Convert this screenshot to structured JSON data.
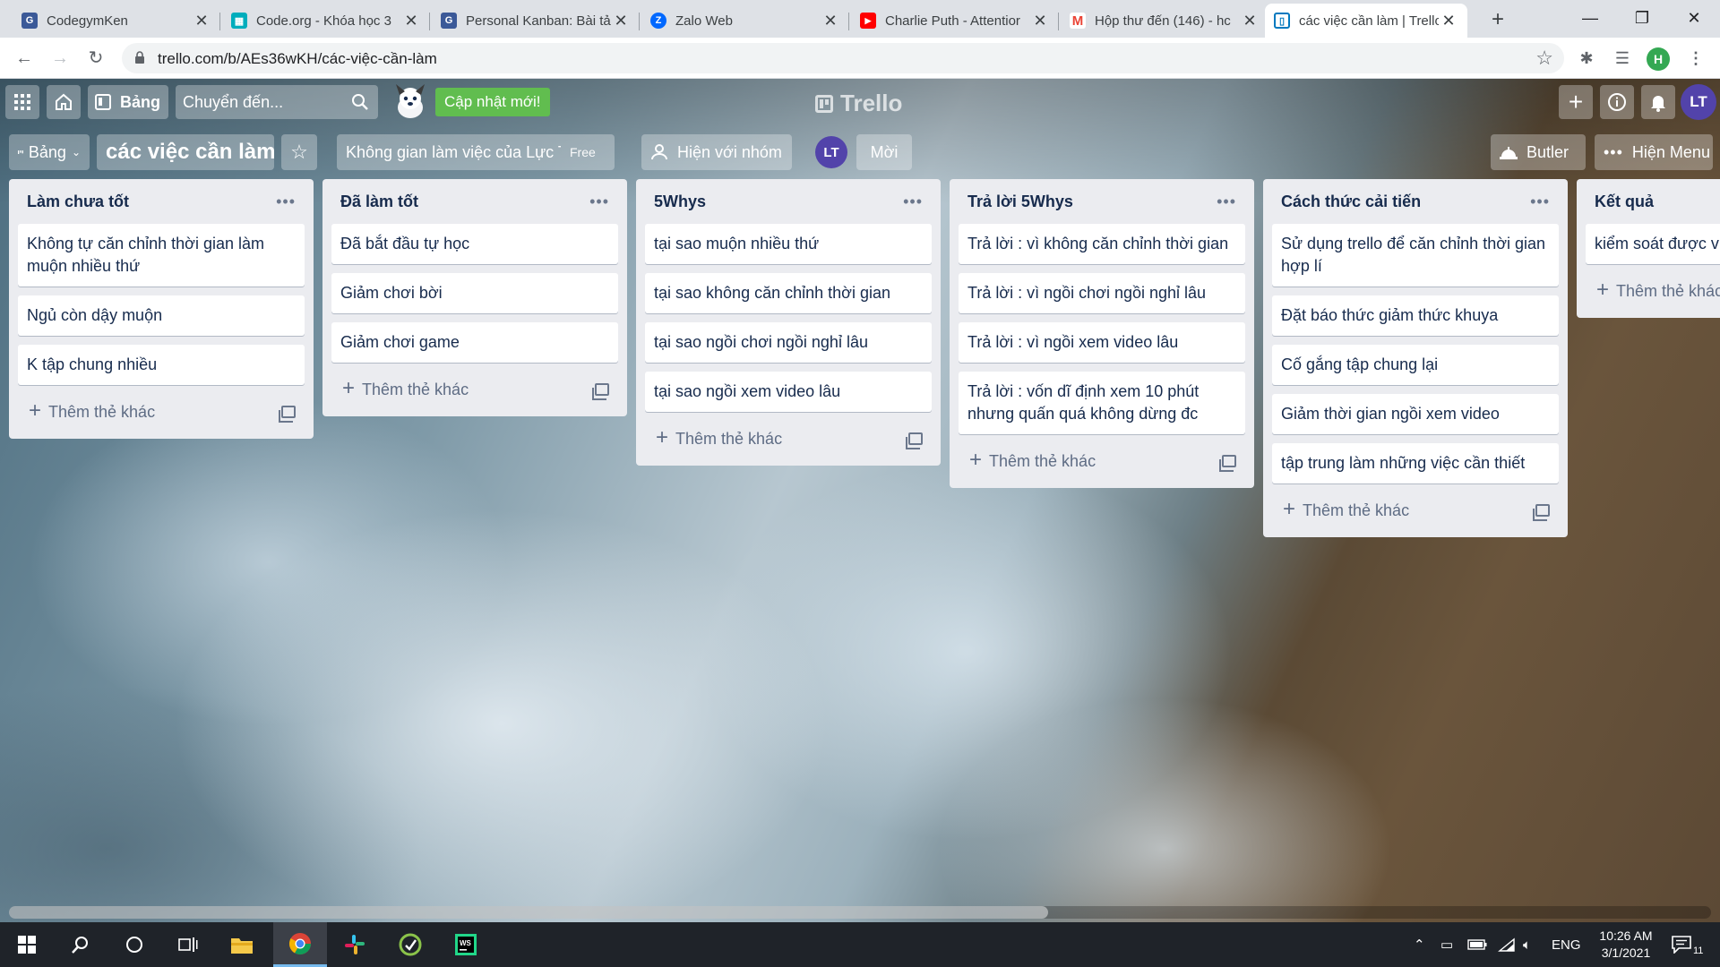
{
  "browser": {
    "tabs": [
      {
        "title": "CodegymKen",
        "favicon": "codegym-icon",
        "color": "#3b5998",
        "glyph": "G"
      },
      {
        "title": "Code.org - Khóa học 3",
        "favicon": "codeorg-icon",
        "color": "#00adbc",
        "glyph": "▦"
      },
      {
        "title": "Personal Kanban: Bài tả",
        "favicon": "codegym-icon",
        "color": "#3b5998",
        "glyph": "G"
      },
      {
        "title": "Zalo Web",
        "favicon": "zalo-icon",
        "color": "#0068ff",
        "glyph": "Z"
      },
      {
        "title": "Charlie Puth - Attentior",
        "favicon": "youtube-icon",
        "color": "#ff0000",
        "glyph": "▶"
      },
      {
        "title": "Hộp thư đến (146) - hc",
        "favicon": "gmail-icon",
        "color": "#ea4335",
        "glyph": "M"
      },
      {
        "title": "các việc cần làm | Trello",
        "favicon": "trello-icon",
        "color": "#0079bf",
        "glyph": "▯"
      }
    ],
    "url": "trello.com/b/AEs36wKH/các-việc-cần-làm",
    "profile_initial": "H"
  },
  "trello": {
    "header": {
      "boards_label": "Bảng",
      "search_placeholder": "Chuyển đến...",
      "update_label": "Cập nhật mới!",
      "logo_text": "Trello",
      "avatar_initials": "LT"
    },
    "board": {
      "switcher_label": "Bảng",
      "title": "các việc cần làm",
      "workspace": "Không gian làm việc của Lực Tr",
      "workspace_badge": "Free",
      "visibility": "Hiện với nhóm",
      "member_initials": "LT",
      "invite": "Mời",
      "butler": "Butler",
      "menu": "Hiện Menu"
    },
    "add_card_label": "Thêm thẻ khác",
    "lists": [
      {
        "name": "Làm chưa tốt",
        "cards": [
          "Không tự căn chỉnh thời gian làm muộn nhiều thứ",
          "Ngủ còn dậy muộn",
          "K tập chung nhiều"
        ]
      },
      {
        "name": "Đã làm tốt",
        "cards": [
          "Đã bắt đầu tự học",
          "Giảm chơi bời",
          "Giảm chơi game"
        ]
      },
      {
        "name": "5Whys",
        "cards": [
          "tại sao muộn nhiều thứ",
          "tại sao không căn chỉnh thời gian",
          "tại sao ngồi chơi ngồi nghỉ lâu",
          "tại sao ngồi xem video lâu"
        ]
      },
      {
        "name": "Trả lời 5Whys",
        "cards": [
          "Trả lời : vì không căn chỉnh thời gian",
          "Trả lời : vì ngồi chơi ngồi nghỉ lâu",
          "Trả lời : vì ngồi xem video lâu",
          "Trả lời : vốn dĩ định xem 10 phút nhưng quấn quá không dừng đc"
        ]
      },
      {
        "name": "Cách thức cải tiến",
        "cards": [
          "Sử dụng trello để căn chỉnh thời gian hợp lí",
          "Đặt báo thức giảm thức khuya",
          "Cố gắng tập chung lại",
          "Giảm thời gian ngồi xem video",
          "tập trung làm những việc cần thiết"
        ]
      },
      {
        "name": "Kết quả",
        "cards": [
          "kiểm soát được việc được tật xấu"
        ]
      }
    ]
  },
  "taskbar": {
    "language": "ENG",
    "time": "10:26 AM",
    "date": "3/1/2021",
    "notification_count": "11"
  }
}
